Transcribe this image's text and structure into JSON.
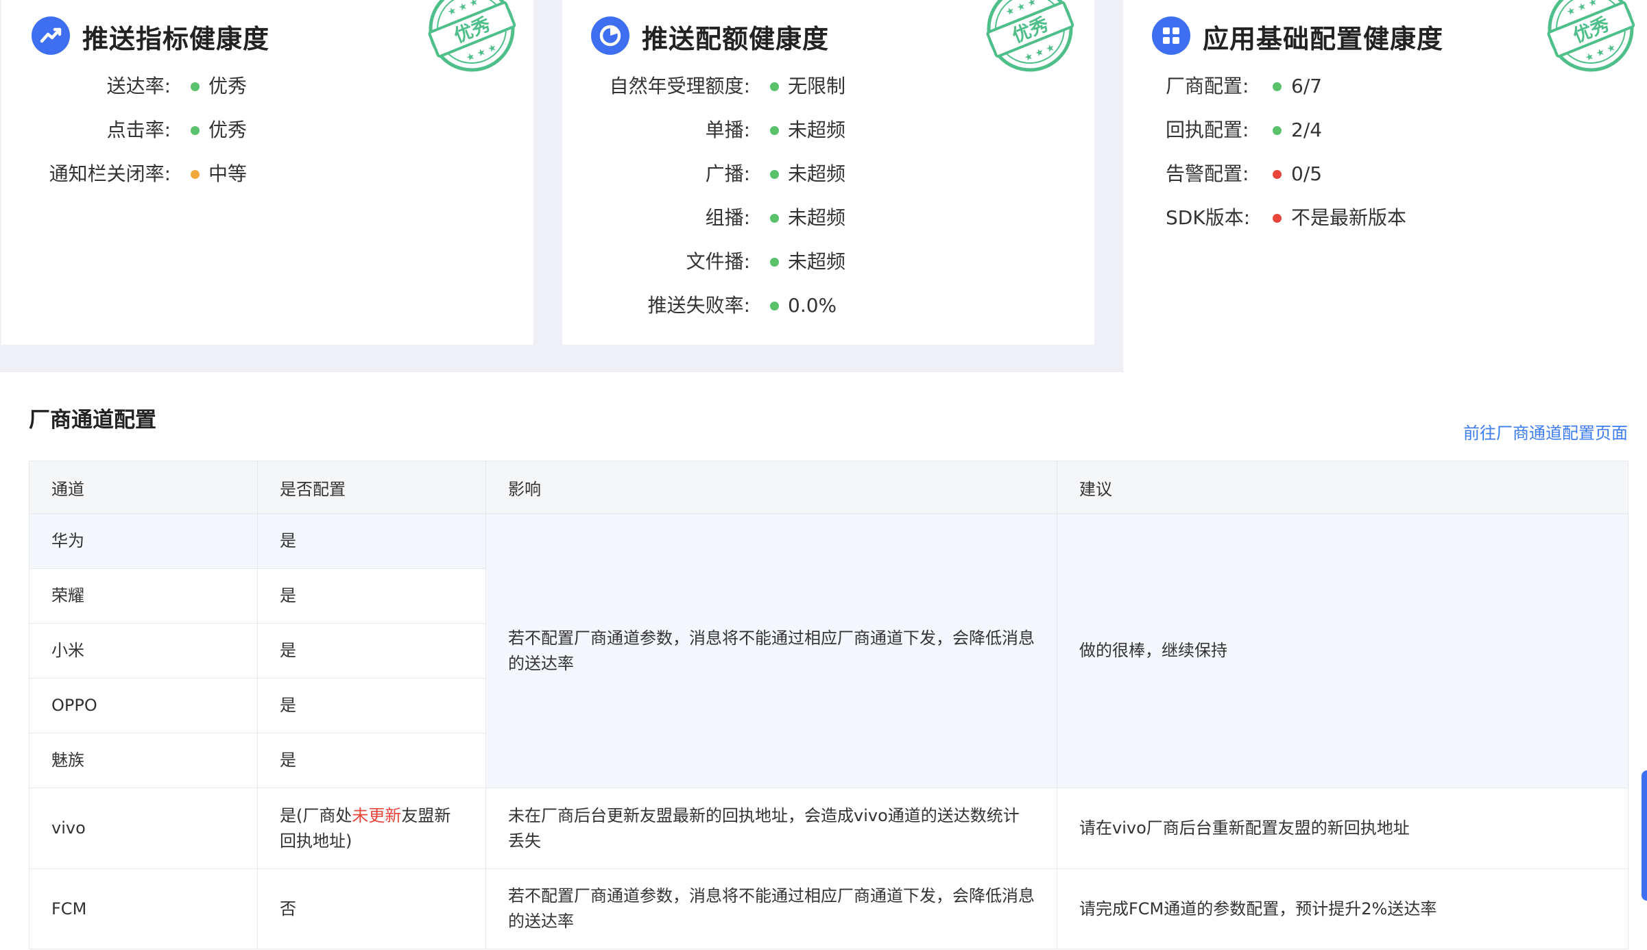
{
  "cards": [
    {
      "title": "推送指标健康度",
      "icon": "trend-chart-icon",
      "stamp": "优秀",
      "rows": [
        {
          "label": "送达率:",
          "status": "green",
          "value": "优秀"
        },
        {
          "label": "点击率:",
          "status": "green",
          "value": "优秀"
        },
        {
          "label": "通知栏关闭率:",
          "status": "orange",
          "value": "中等"
        }
      ]
    },
    {
      "title": "推送配额健康度",
      "icon": "pie-chart-icon",
      "stamp": "优秀",
      "rows": [
        {
          "label": "自然年受理额度:",
          "status": "green",
          "value": "无限制"
        },
        {
          "label": "单播:",
          "status": "green",
          "value": "未超频"
        },
        {
          "label": "广播:",
          "status": "green",
          "value": "未超频"
        },
        {
          "label": "组播:",
          "status": "green",
          "value": "未超频"
        },
        {
          "label": "文件播:",
          "status": "green",
          "value": "未超频"
        },
        {
          "label": "推送失败率:",
          "status": "green",
          "value": "0.0%"
        }
      ]
    },
    {
      "title": "应用基础配置健康度",
      "icon": "grid-apps-icon",
      "stamp": "优秀",
      "rows": [
        {
          "label": "厂商配置:",
          "status": "green",
          "value": "6/7"
        },
        {
          "label": "回执配置:",
          "status": "green",
          "value": "2/4"
        },
        {
          "label": "告警配置:",
          "status": "red",
          "value": "0/5"
        },
        {
          "label": "SDK版本:",
          "status": "red",
          "value": "不是最新版本"
        }
      ]
    }
  ],
  "colors": {
    "green": "#5ac26d",
    "orange": "#f2a93b",
    "red": "#e8453c",
    "accent": "#3d6ff0",
    "stamp": "#4fbf8a"
  },
  "channel_section": {
    "title": "厂商通道配置",
    "link": "前往厂商通道配置页面",
    "headers": [
      "通道",
      "是否配置",
      "影响",
      "建议"
    ],
    "rows": [
      {
        "channel": "华为",
        "configured": "是"
      },
      {
        "channel": "荣耀",
        "configured": "是"
      },
      {
        "channel": "小米",
        "configured": "是"
      },
      {
        "channel": "OPPO",
        "configured": "是"
      },
      {
        "channel": "魅族",
        "configured": "是"
      }
    ],
    "group_impact": "若不配置厂商通道参数，消息将不能通过相应厂商通道下发，会降低消息的送达率",
    "group_advice": "做的很棒，继续保持",
    "vivo": {
      "channel": "vivo",
      "configured_prefix": "是(厂商处",
      "configured_highlight": "未更新",
      "configured_suffix": "友盟新回执地址)",
      "impact": "未在厂商后台更新友盟最新的回执地址，会造成vivo通道的送达数统计丢失",
      "advice": "请在vivo厂商后台重新配置友盟的新回执地址"
    },
    "fcm": {
      "channel": "FCM",
      "configured": "否",
      "impact": "若不配置厂商通道参数，消息将不能通过相应厂商通道下发，会降低消息的送达率",
      "advice": "请完成FCM通道的参数配置，预计提升2%送达率"
    }
  }
}
